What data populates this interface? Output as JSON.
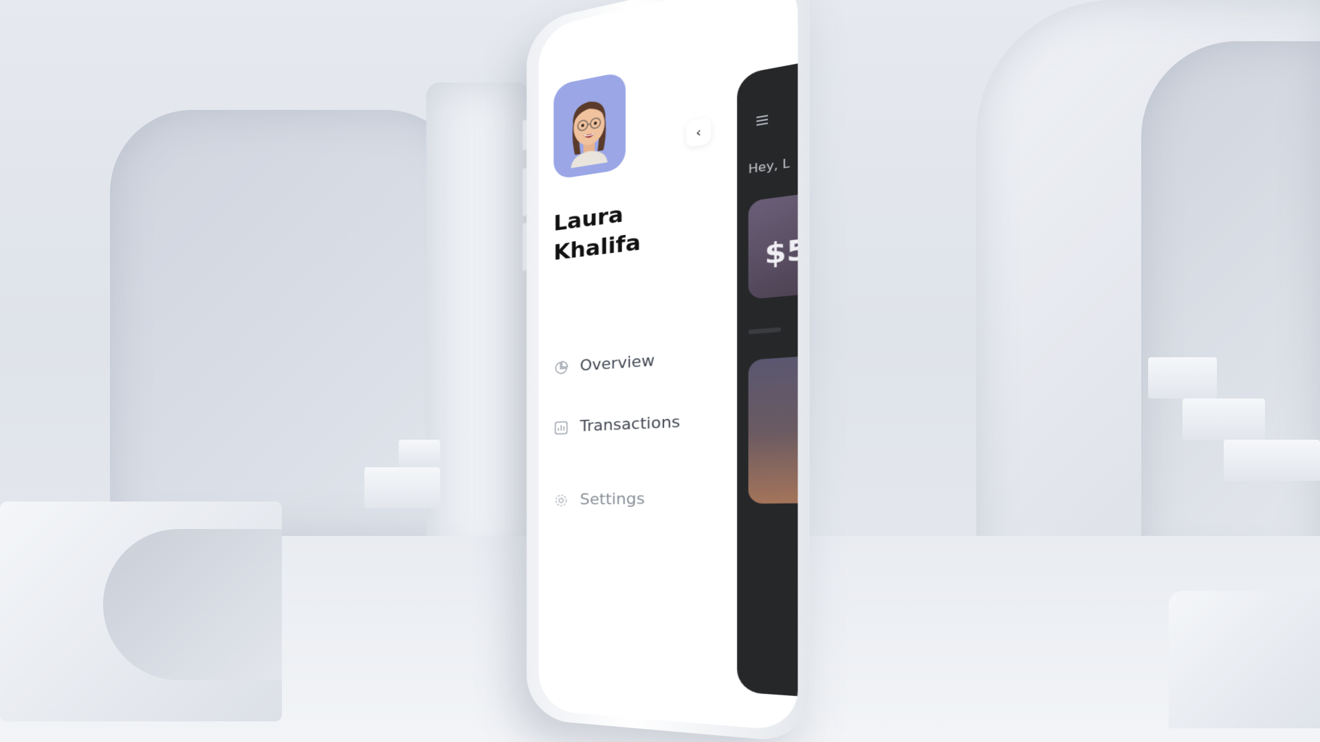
{
  "drawer": {
    "profile": {
      "first_name": "Laura",
      "last_name": "Khalifa",
      "avatar_bg": "#9aa6e6"
    },
    "back_icon": "chevron-left-icon",
    "back_glyph": "‹",
    "menu": [
      {
        "label": "Overview",
        "icon": "pie-chart-icon"
      },
      {
        "label": "Transactions",
        "icon": "bar-chart-icon"
      },
      {
        "label": "Settings",
        "icon": "gear-icon"
      }
    ]
  },
  "dashboard": {
    "greeting": "Hey, L",
    "amount": "$5",
    "menu_icon": "hamburger-icon",
    "bg": "#262729"
  }
}
